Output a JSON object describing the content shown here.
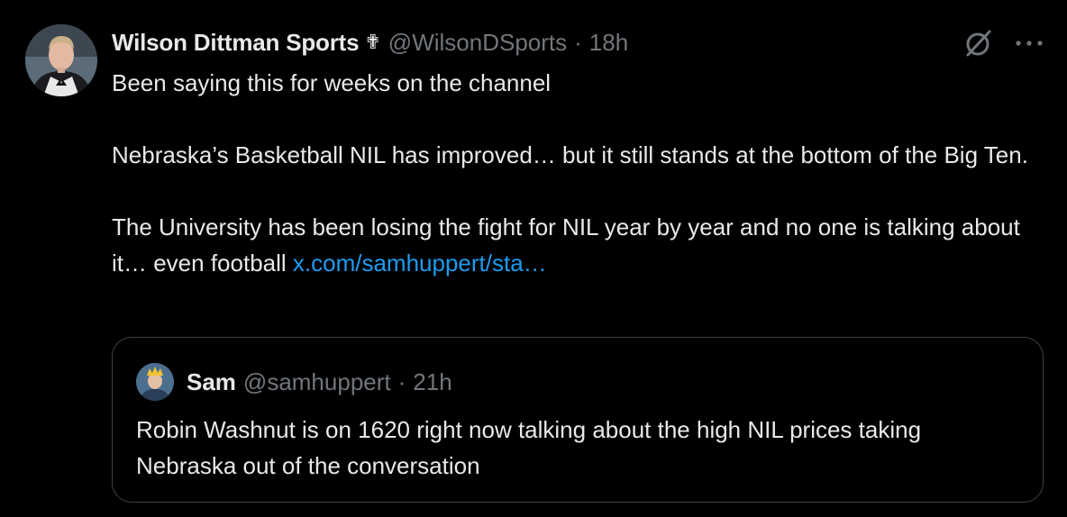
{
  "tweet": {
    "display_name": "Wilson Dittman Sports",
    "badge": "✟",
    "handle": "@WilsonDSports",
    "separator": "·",
    "time": "18h",
    "paragraph_1": "Been saying this for weeks on the channel",
    "paragraph_2": "Nebraska’s Basketball NIL has improved… but it still stands at the bottom of the Big Ten.",
    "paragraph_3_text": "The University has been losing the fight for NIL year by year and no one is talking about it… even football ",
    "link_text": "x.com/samhuppert/sta…",
    "icons": {
      "grok": "grok-slash-circle-icon",
      "more": "more-horizontal-icon"
    },
    "colors": {
      "background": "#000000",
      "text": "#e7e9ea",
      "secondary": "#71767b",
      "link": "#1d9bf0",
      "border": "#3e4144"
    }
  },
  "quote": {
    "display_name": "Sam",
    "handle": "@samhuppert",
    "separator": "·",
    "time": "21h",
    "text": "Robin Washnut is on 1620 right now talking about the high NIL prices taking Nebraska out of the conversation"
  }
}
